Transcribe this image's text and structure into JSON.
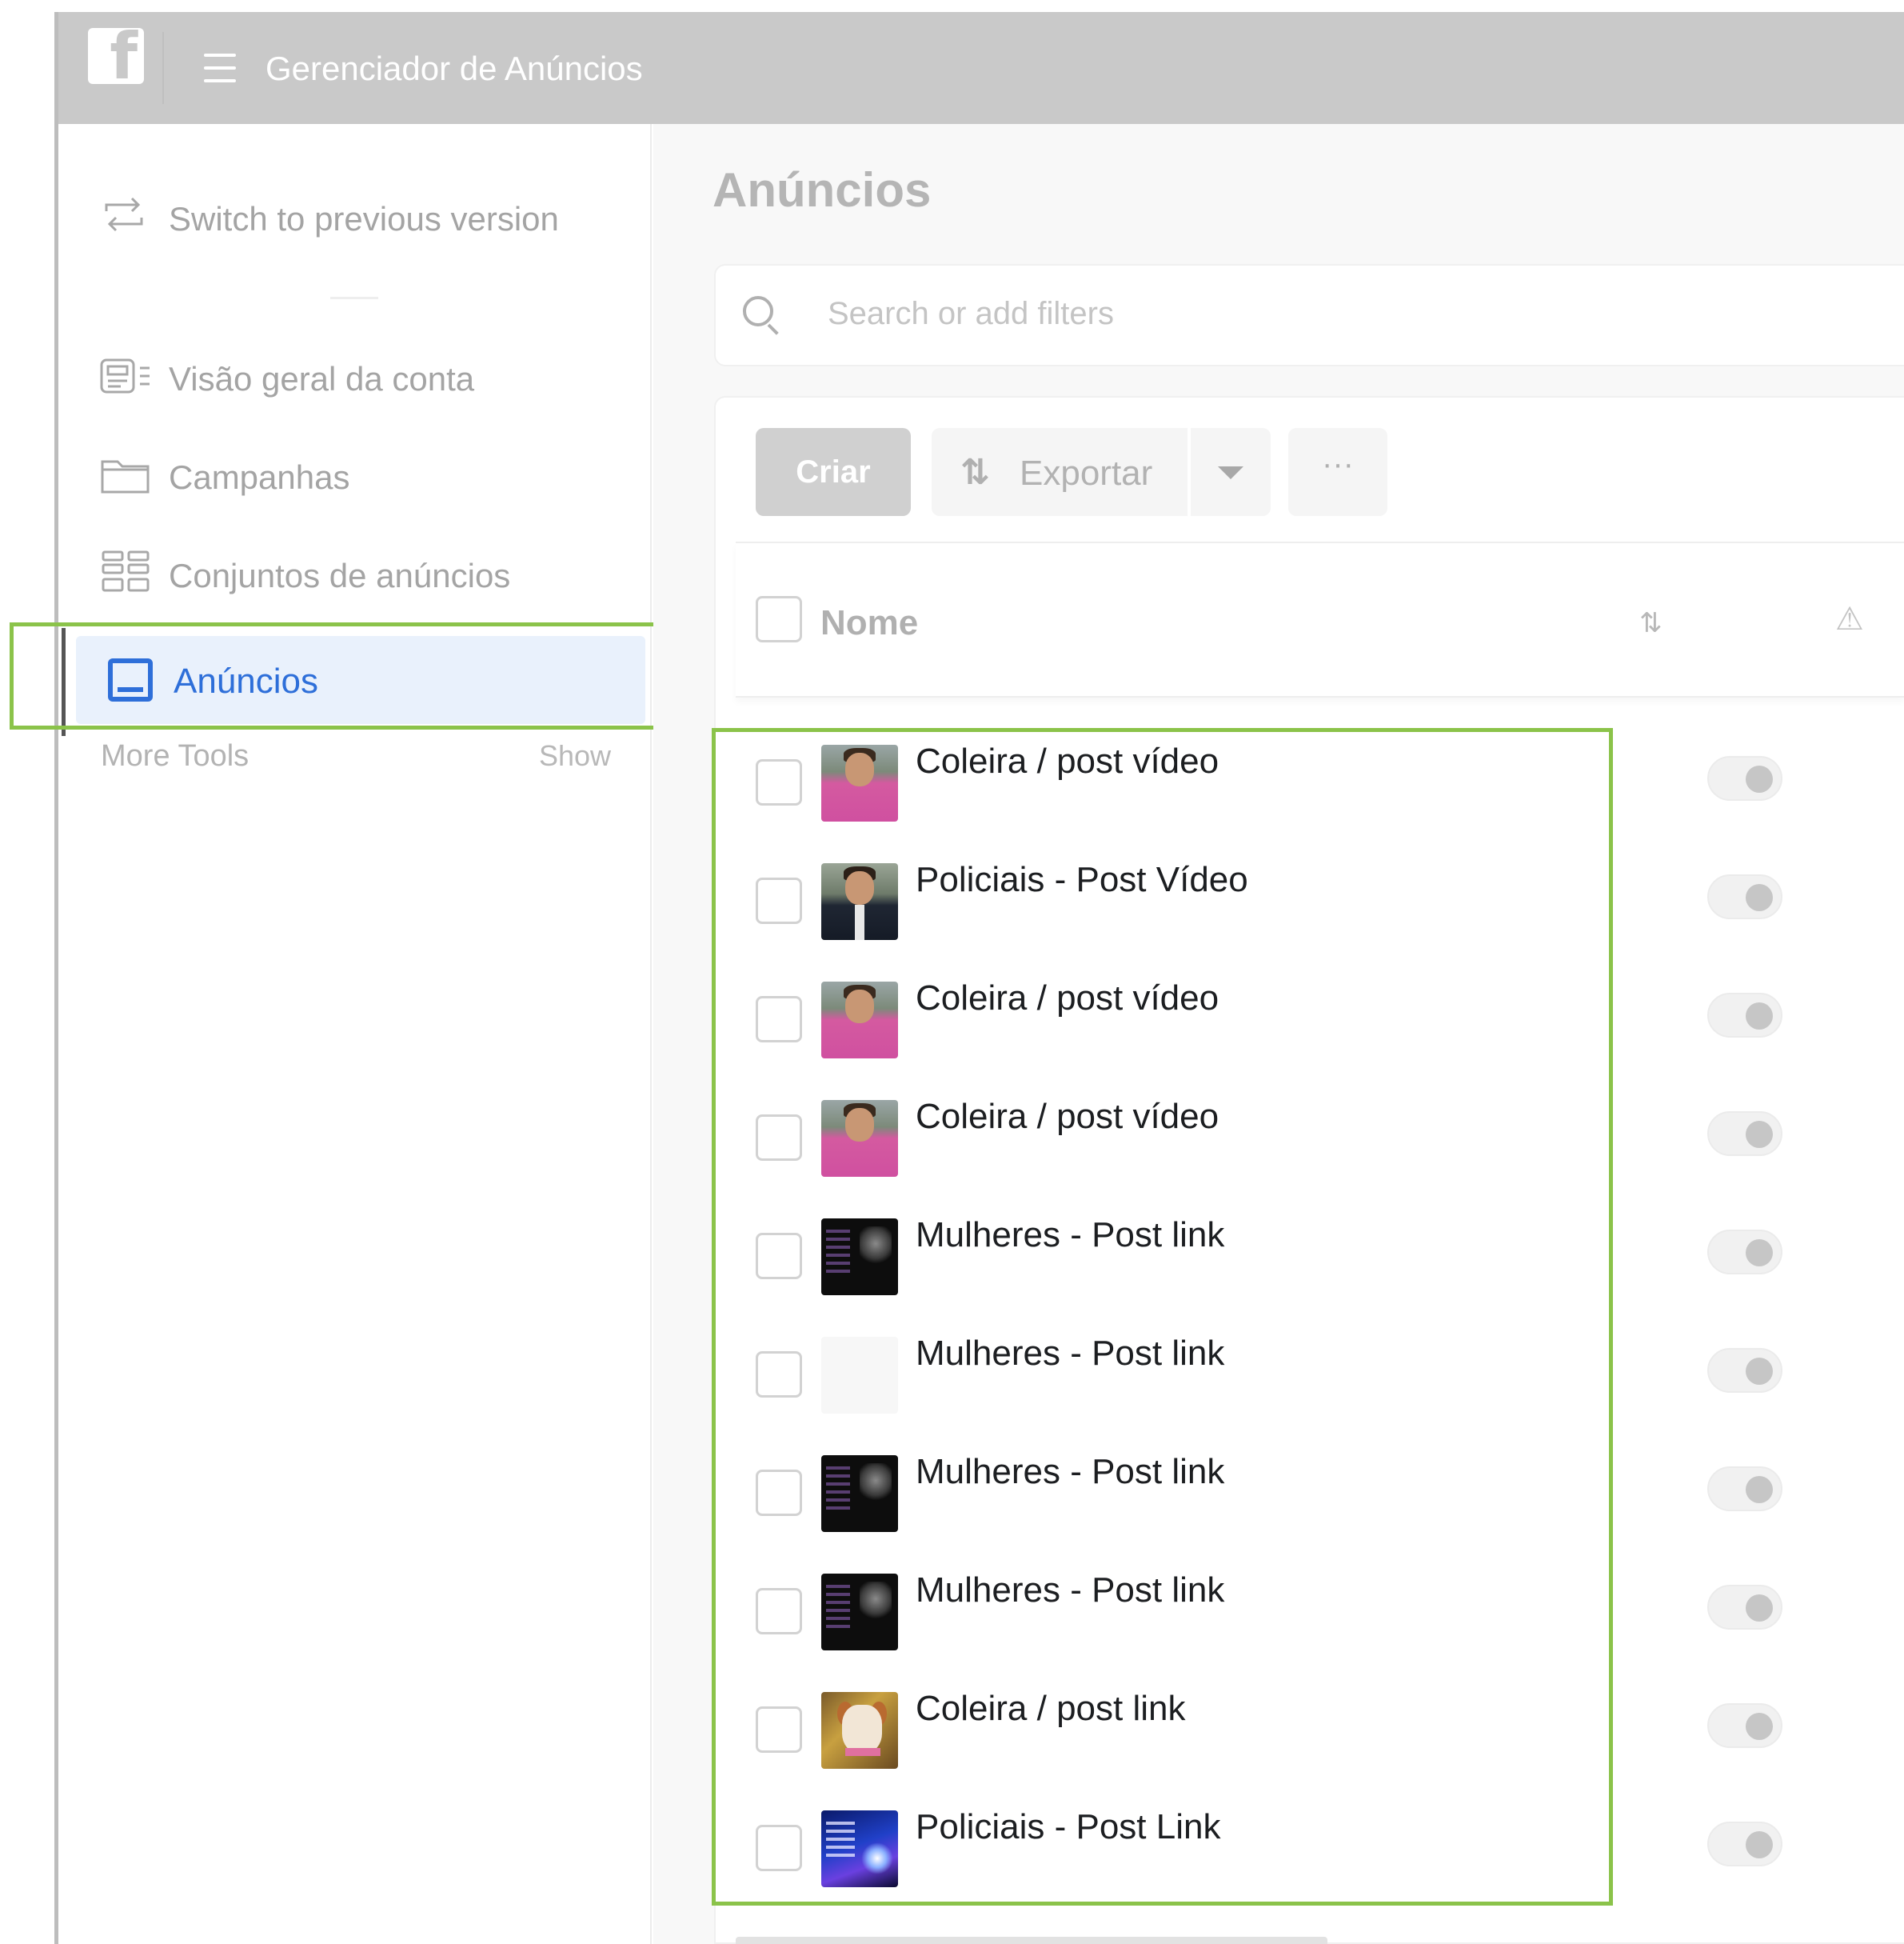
{
  "app": {
    "title": "Gerenciador de Anúncios"
  },
  "sidebar": {
    "switch_label": "Switch to previous version",
    "items": [
      {
        "label": "Visão geral da conta",
        "icon": "account-overview-icon"
      },
      {
        "label": "Campanhas",
        "icon": "folder-icon"
      },
      {
        "label": "Conjuntos de anúncios",
        "icon": "grid-icon"
      },
      {
        "label": "Anúncios",
        "icon": "ad-icon",
        "active": true
      }
    ],
    "more_tools": "More Tools",
    "show_label": "Show"
  },
  "main": {
    "title": "Anúncios",
    "search_placeholder": "Search or add filters",
    "toolbar": {
      "create_label": "Criar",
      "export_label": "Exportar",
      "more_label": "···"
    },
    "table": {
      "name_header": "Nome",
      "rows": [
        {
          "name": "Coleira / post vídeo",
          "thumb": "pink",
          "active": false
        },
        {
          "name": "Policiais - Post Vídeo",
          "thumb": "suit",
          "active": false
        },
        {
          "name": "Coleira / post vídeo",
          "thumb": "pink",
          "active": false
        },
        {
          "name": "Coleira / post vídeo",
          "thumb": "pink",
          "active": false
        },
        {
          "name": "Mulheres - Post link",
          "thumb": "dark",
          "active": false
        },
        {
          "name": "Mulheres - Post link",
          "thumb": "empty",
          "active": false
        },
        {
          "name": "Mulheres - Post link",
          "thumb": "dark",
          "active": false
        },
        {
          "name": "Mulheres - Post link",
          "thumb": "dark",
          "active": false
        },
        {
          "name": "Coleira / post link",
          "thumb": "dog",
          "active": false
        },
        {
          "name": "Policiais - Post Link",
          "thumb": "police",
          "active": false
        }
      ]
    }
  },
  "colors": {
    "topbar": "#c9c9c9",
    "accent": "#2e6fd9",
    "highlight": "#8bc34a"
  }
}
